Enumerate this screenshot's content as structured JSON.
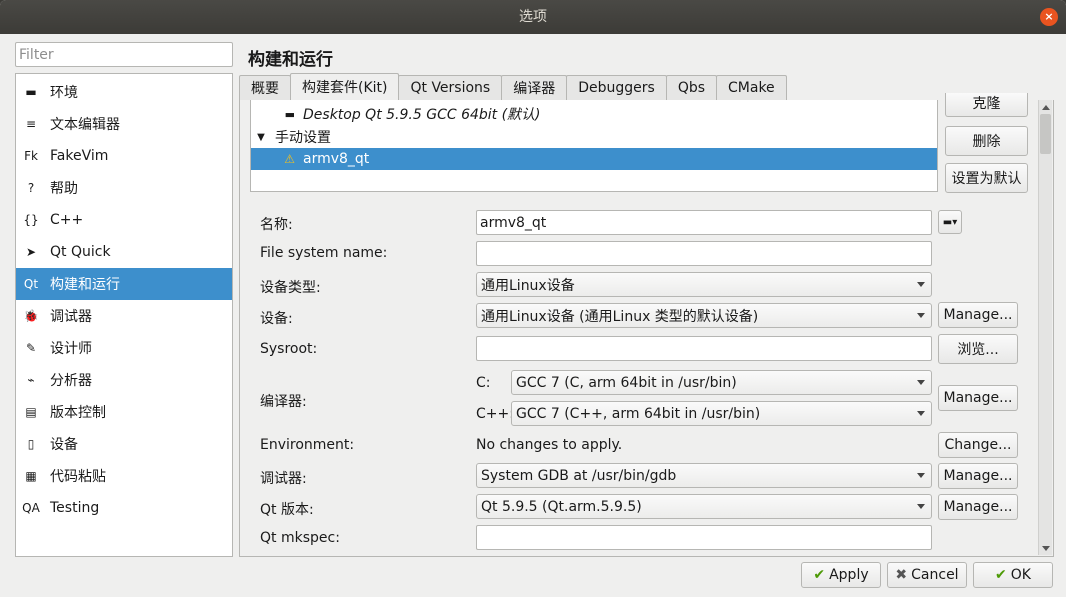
{
  "window": {
    "title": "选项",
    "close_glyph": "×"
  },
  "filter": {
    "placeholder": "Filter",
    "value": ""
  },
  "categories": [
    {
      "label": "环境",
      "icon": "monitor-icon",
      "glyph": "▬"
    },
    {
      "label": "文本编辑器",
      "icon": "text-editor-icon",
      "glyph": "≡"
    },
    {
      "label": "FakeVim",
      "icon": "fakevim-icon",
      "glyph": "Fk"
    },
    {
      "label": "帮助",
      "icon": "help-icon",
      "glyph": "?"
    },
    {
      "label": "C++",
      "icon": "cpp-braces-icon",
      "glyph": "{}"
    },
    {
      "label": "Qt Quick",
      "icon": "qt-quick-icon",
      "glyph": "➤"
    },
    {
      "label": "构建和运行",
      "icon": "build-run-icon",
      "glyph": "Qt"
    },
    {
      "label": "调试器",
      "icon": "debugger-icon",
      "glyph": "🐞"
    },
    {
      "label": "设计师",
      "icon": "designer-icon",
      "glyph": "✎"
    },
    {
      "label": "分析器",
      "icon": "analyzer-icon",
      "glyph": "⌁"
    },
    {
      "label": "版本控制",
      "icon": "version-control-icon",
      "glyph": "▤"
    },
    {
      "label": "设备",
      "icon": "device-icon",
      "glyph": "▯"
    },
    {
      "label": "代码粘贴",
      "icon": "code-paste-icon",
      "glyph": "▦"
    },
    {
      "label": "Testing",
      "icon": "testing-qa-icon",
      "glyph": "QA"
    }
  ],
  "selected_category": "构建和运行",
  "page_title": "构建和运行",
  "tabs": [
    {
      "label": "概要"
    },
    {
      "label": "构建套件(Kit)"
    },
    {
      "label": "Qt Versions"
    },
    {
      "label": "编译器"
    },
    {
      "label": "Debuggers"
    },
    {
      "label": "Qbs"
    },
    {
      "label": "CMake"
    }
  ],
  "active_tab": "构建套件(Kit)",
  "kit_tree": {
    "auto_kit": "Desktop Qt 5.9.5 GCC 64bit (默认)",
    "manual_group": "手动设置",
    "manual_kit": "armv8_qt",
    "expand_glyph": "▼",
    "warning_glyph": "⚠"
  },
  "kit_buttons": {
    "clone": "克隆",
    "remove": "删除",
    "make_default": "设置为默认"
  },
  "form": {
    "name_label": "名称:",
    "name_value": "armv8_qt",
    "fs_name_label": "File system name:",
    "fs_name_value": "",
    "device_type_label": "设备类型:",
    "device_type_value": "通用Linux设备",
    "device_label": "设备:",
    "device_value": "通用Linux设备 (通用Linux 类型的默认设备)",
    "sysroot_label": "Sysroot:",
    "sysroot_value": "",
    "compiler_label": "编译器:",
    "compiler_c_label": "C:",
    "compiler_c_value": "GCC 7 (C, arm 64bit in /usr/bin)",
    "compiler_cpp_label": "C++:",
    "compiler_cpp_value": "GCC 7 (C++, arm 64bit in /usr/bin)",
    "env_label": "Environment:",
    "env_value": "No changes to apply.",
    "debugger_label": "调试器:",
    "debugger_value": "System GDB at /usr/bin/gdb",
    "qt_version_label": "Qt 版本:",
    "qt_version_value": "Qt 5.9.5 (Qt.arm.5.9.5)",
    "mkspec_label": "Qt mkspec:",
    "mkspec_value": ""
  },
  "form_buttons": {
    "manage": "Manage...",
    "browse": "浏览...",
    "change": "Change..."
  },
  "dialog_buttons": {
    "apply": "Apply",
    "cancel": "Cancel",
    "ok": "OK"
  },
  "colors": {
    "selection": "#3d8fcc",
    "close": "#e95420",
    "titlebar": "#3c3b37"
  }
}
